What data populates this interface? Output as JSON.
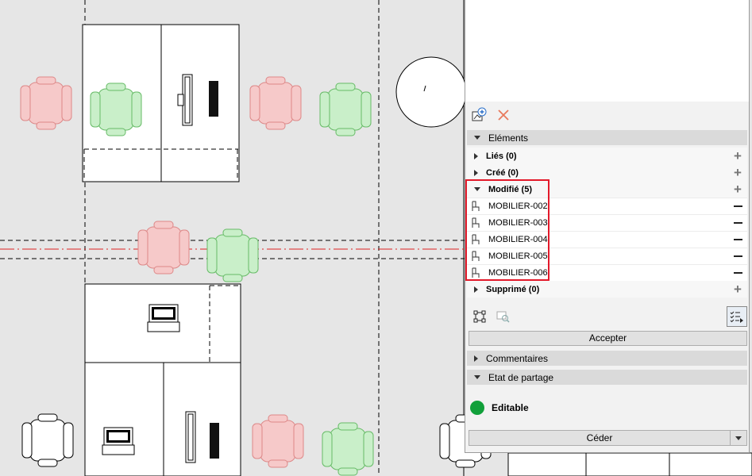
{
  "panel": {
    "toolbar": {
      "add_icon": "add-layer-icon",
      "delete_icon": "delete-x-icon"
    },
    "sections": {
      "elements": {
        "label": "Eléments"
      },
      "comments": {
        "label": "Commentaires"
      },
      "sharing": {
        "label": "Etat de partage"
      }
    },
    "groups": {
      "linked": "Liés (0)",
      "created": "Créé (0)",
      "modified": "Modifié (5)",
      "deleted": "Supprimé (0)"
    },
    "modified_items": [
      "MOBILIER-002",
      "MOBILIER-003",
      "MOBILIER-004",
      "MOBILIER-005",
      "MOBILIER-006"
    ],
    "accept_label": "Accepter",
    "status_text": "Editable",
    "status_color": "#11a03a",
    "release_label": "Céder"
  },
  "colors": {
    "highlight": "#e3192a",
    "chair_modified": "#f6c9c9",
    "chair_new": "#c9efc9"
  }
}
